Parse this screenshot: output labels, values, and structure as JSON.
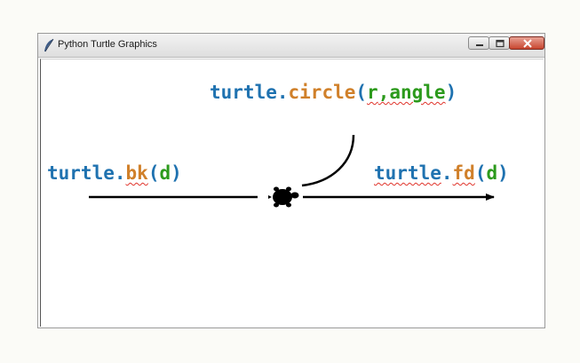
{
  "window": {
    "title": "Python Turtle Graphics",
    "controls": [
      "minimize",
      "maximize",
      "close"
    ]
  },
  "labels": {
    "circle": {
      "object": "turtle",
      "dot": ".",
      "method": "circle",
      "open": "(",
      "arg1": "r",
      "sep": ",",
      "arg2": "angle",
      "close": ")"
    },
    "bk": {
      "object": "turtle",
      "dot": ".",
      "method": "bk",
      "open": "(",
      "arg": "d",
      "close": ")"
    },
    "fd": {
      "object": "turtle",
      "dot": ".",
      "method": "fd",
      "open": "(",
      "arg": "d",
      "close": ")"
    }
  },
  "colors": {
    "object": "#1f72b0",
    "method": "#d0802a",
    "argument": "#2c9a1c",
    "lines": "#000000"
  },
  "icons": [
    "feather-icon",
    "minimize-icon",
    "maximize-icon",
    "close-icon",
    "turtle-icon"
  ]
}
